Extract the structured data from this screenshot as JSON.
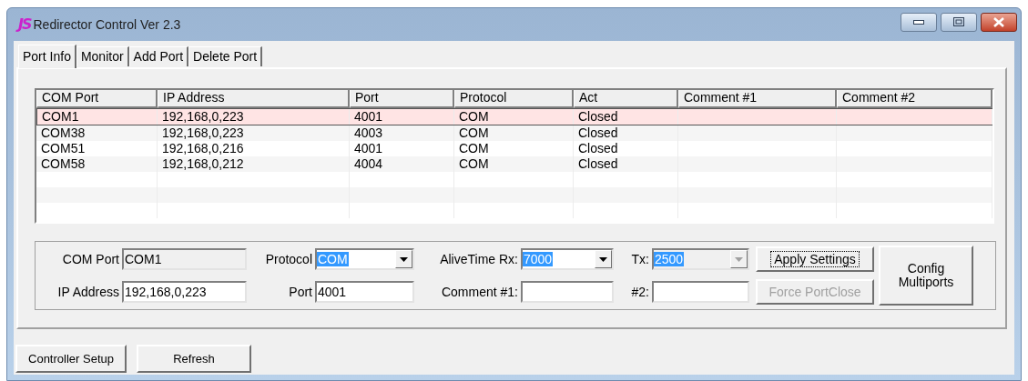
{
  "window": {
    "logo": "JS",
    "title": "Redirector Control Ver 2.3"
  },
  "tabs": [
    {
      "label": "Port Info",
      "selected": true
    },
    {
      "label": "Monitor",
      "selected": false
    },
    {
      "label": "Add Port",
      "selected": false
    },
    {
      "label": "Delete Port",
      "selected": false
    }
  ],
  "table": {
    "columns": [
      "COM Port",
      "IP Address",
      "Port",
      "Protocol",
      "Act",
      "Comment #1",
      "Comment #2"
    ],
    "rows": [
      {
        "cells": [
          "COM1",
          "192,168,0,223",
          "4001",
          "COM",
          "Closed"
        ],
        "selected": true
      },
      {
        "cells": [
          "COM38",
          "192,168,0,223",
          "4003",
          "COM",
          "Closed"
        ],
        "selected": false
      },
      {
        "cells": [
          "COM51",
          "192,168,0,216",
          "4001",
          "COM",
          "Closed"
        ],
        "selected": false
      },
      {
        "cells": [
          "COM58",
          "192,168,0,212",
          "4004",
          "COM",
          "Closed"
        ],
        "selected": false
      }
    ]
  },
  "settings": {
    "rows": [
      [
        {
          "label": "COM Port",
          "kind": "field",
          "value": "COM1",
          "disabled": true
        },
        {
          "label": "Protocol",
          "kind": "combo",
          "value": "COM",
          "disabled": false,
          "highlighted": true
        },
        {
          "label": "AliveTime Rx:",
          "kind": "combo",
          "value": "7000",
          "disabled": false,
          "highlighted": true
        },
        {
          "label": "Tx:",
          "kind": "combo",
          "value": "2500",
          "disabled": true,
          "highlighted": true
        }
      ],
      [
        {
          "label": "IP Address",
          "kind": "field",
          "value": "192,168,0,223",
          "disabled": false
        },
        {
          "label": "Port",
          "kind": "field",
          "value": "4001",
          "disabled": false
        },
        {
          "label": "Comment #1:",
          "kind": "field",
          "disabled": false
        },
        {
          "label": "#2:",
          "kind": "field",
          "disabled": false
        }
      ]
    ],
    "buttons": [
      {
        "label": "Apply Settings",
        "disabled": false,
        "focused": true
      },
      {
        "label": "Force PortClose",
        "disabled": true,
        "focused": false
      }
    ],
    "config_button": "Config\nMultiports"
  },
  "bottom_buttons": [
    "Controller Setup",
    "Refresh"
  ]
}
